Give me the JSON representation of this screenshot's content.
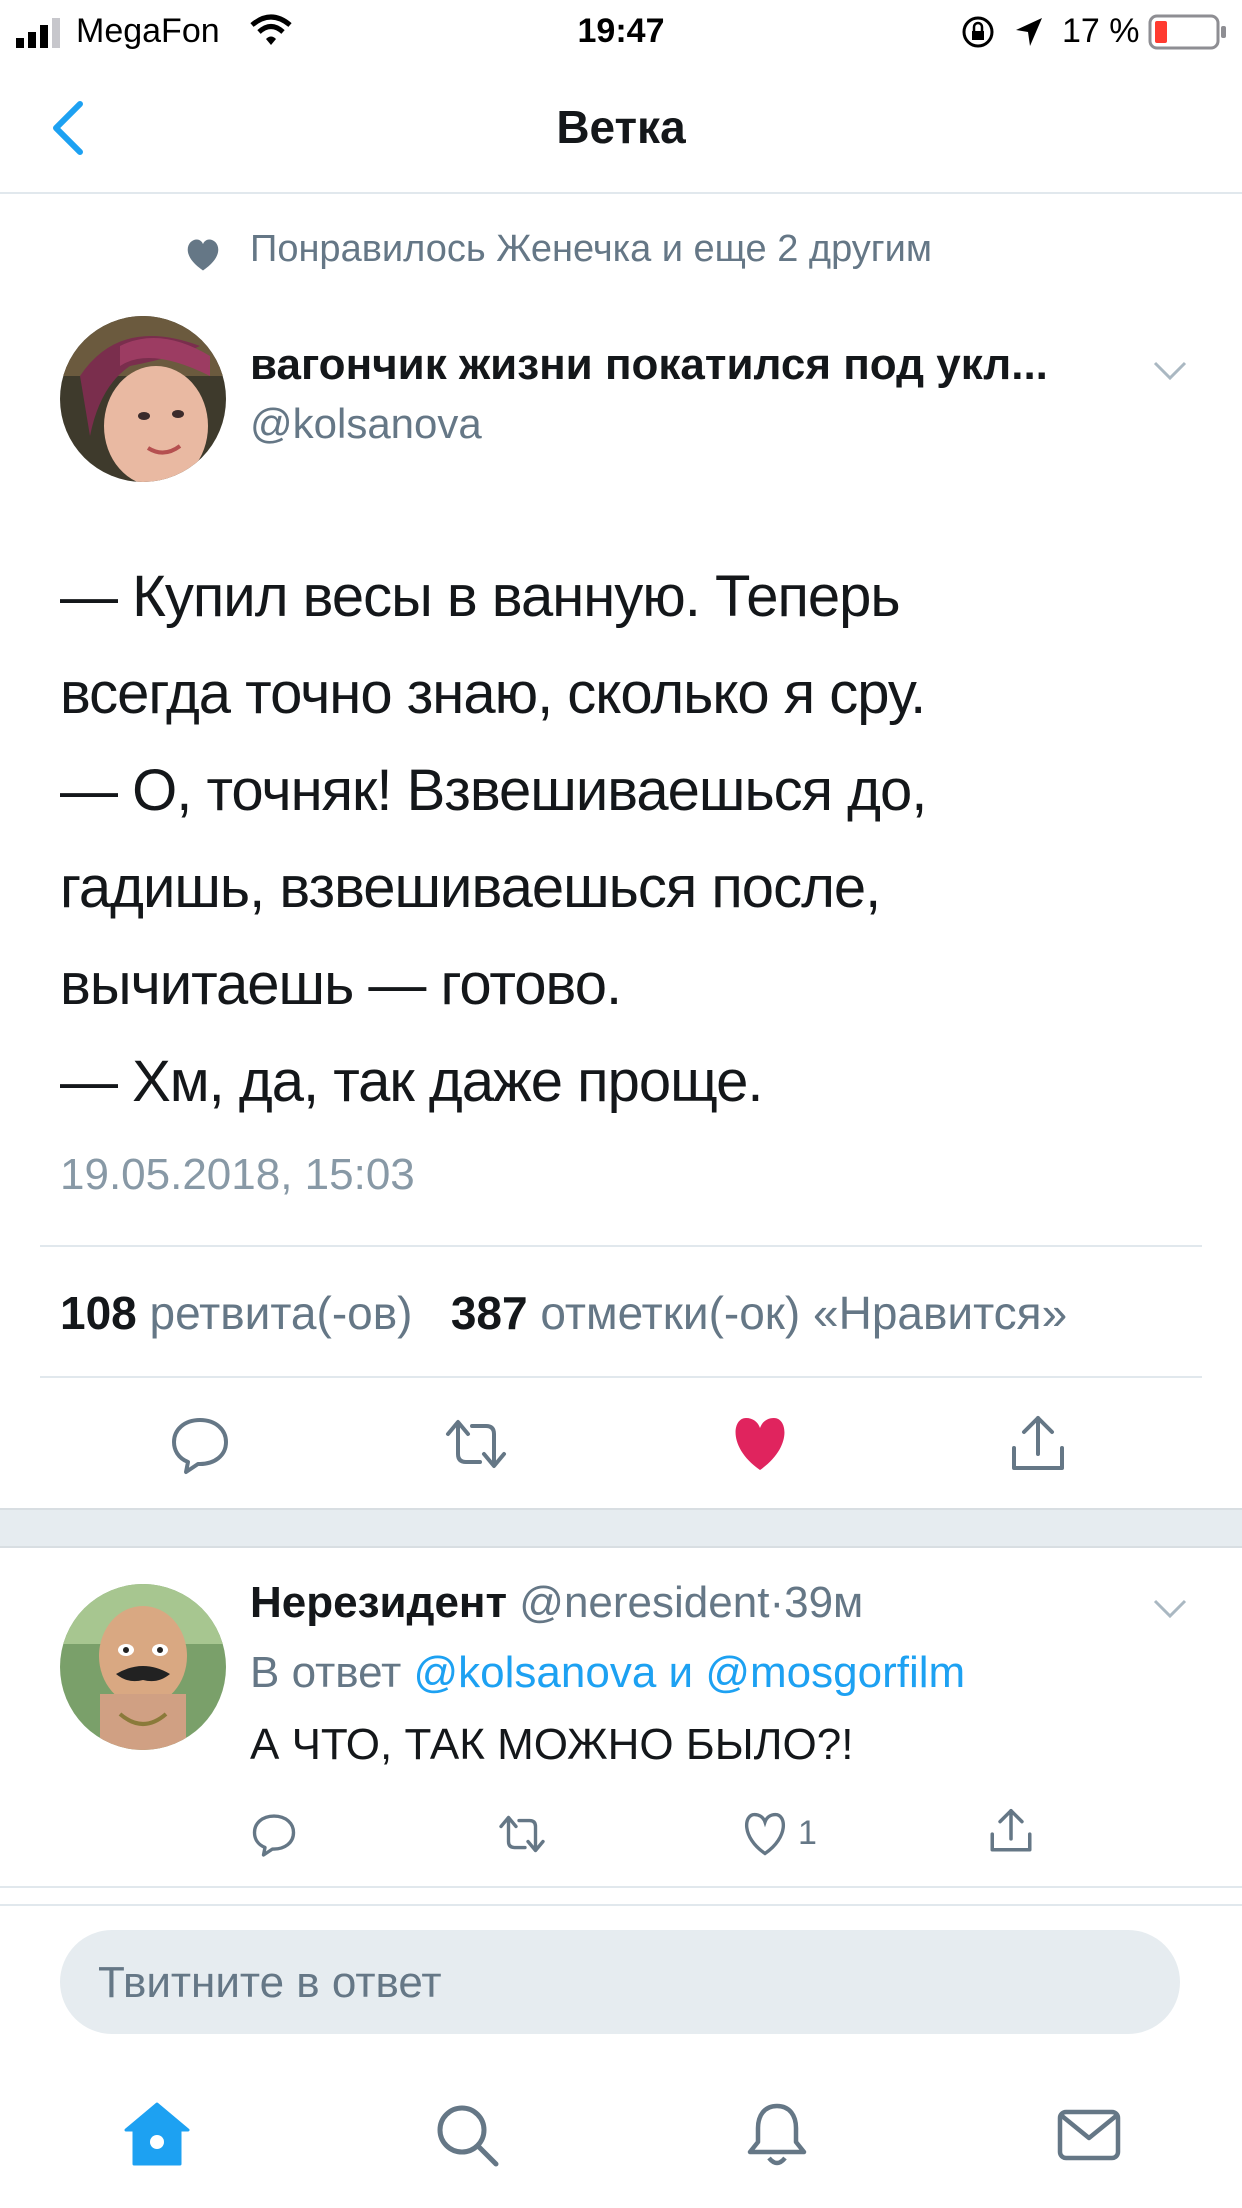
{
  "status_bar": {
    "carrier": "MegaFon",
    "time": "19:47",
    "battery": "17 %"
  },
  "nav": {
    "title": "Ветка"
  },
  "social_context": {
    "text": "Понравилось Женечка и еще 2 другим"
  },
  "tweet": {
    "author_name": "вагончик жизни покатился под укл...",
    "author_handle": "@kolsanova",
    "lines": [
      "— Купил весы в ванную. Теперь",
      "всегда точно знаю, сколько я сру.",
      "— О, точняк! Взвешиваешься до,",
      "гадишь, взвешиваешься после,",
      "вычитаешь — готово.",
      "— Хм, да, так даже проще."
    ],
    "timestamp": "19.05.2018, 15:03",
    "retweets_count": "108",
    "retweets_label": "ретвита(-ов)",
    "likes_count": "387",
    "likes_label": "отметки(-ок) «Нравится»",
    "liked": true
  },
  "reply": {
    "author_name": "Нерезидент",
    "author_handle": "@neresident",
    "separator": "·",
    "age": "39м",
    "reply_prefix": "В ответ",
    "reply_user1": "@kolsanova",
    "reply_and": "и",
    "reply_user2": "@mosgorfilm",
    "text": "А ЧТО, ТАК МОЖНО БЫЛО?!",
    "like_count": "1"
  },
  "compose": {
    "placeholder": "Твитните в ответ"
  },
  "colors": {
    "accent": "#1da1f2",
    "like": "#e0245e",
    "muted": "#657786"
  },
  "tab_bar": [
    "home-icon",
    "search-icon",
    "notifications-icon",
    "messages-icon"
  ]
}
